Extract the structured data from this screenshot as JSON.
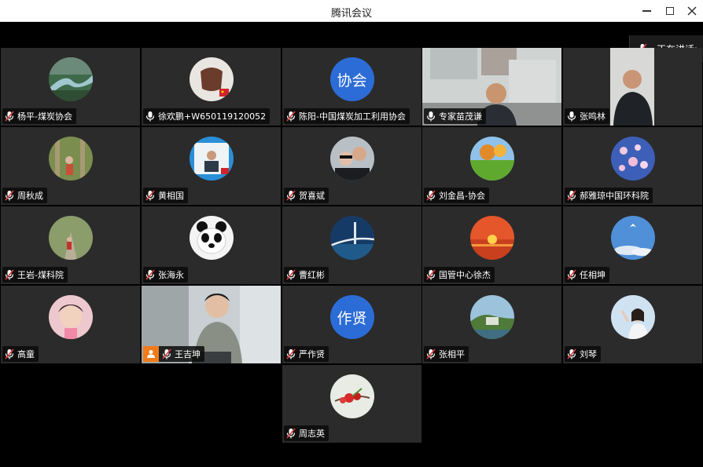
{
  "window": {
    "title": "腾讯会议"
  },
  "speaking": {
    "label": "正在讲话:"
  },
  "participants": [
    {
      "name": "杨平-煤炭协会",
      "muted": true,
      "avatar": "river-photo"
    },
    {
      "name": "徐欢鹏+W650119120052",
      "muted": false,
      "avatar": "fist-photo"
    },
    {
      "name": "陈阳-中国煤炭加工利用协会",
      "muted": true,
      "avatar_text": "协会"
    },
    {
      "name": "专家苗茂谦",
      "muted": false,
      "avatar": "video"
    },
    {
      "name": "张鸣林",
      "muted": false,
      "avatar": "video"
    },
    {
      "name": "周秋成",
      "muted": true,
      "avatar": "forest-photo"
    },
    {
      "name": "黄相国",
      "muted": true,
      "avatar": "portrait-photo"
    },
    {
      "name": "贺喜斌",
      "muted": true,
      "avatar": "couple-photo"
    },
    {
      "name": "刘金昌-协会",
      "muted": true,
      "avatar": "meadow-photo"
    },
    {
      "name": "郝雅琼中国环科院",
      "muted": true,
      "avatar": "blossom-photo"
    },
    {
      "name": "王岩-煤科院",
      "muted": true,
      "avatar": "road-photo"
    },
    {
      "name": "张海永",
      "muted": true,
      "avatar": "panda-photo"
    },
    {
      "name": "曹红彬",
      "muted": true,
      "avatar": "bridge-photo"
    },
    {
      "name": "国管中心徐杰",
      "muted": true,
      "avatar": "sunset-photo"
    },
    {
      "name": "任相坤",
      "muted": true,
      "avatar": "sky-photo"
    },
    {
      "name": "高童",
      "muted": true,
      "avatar": "child-photo"
    },
    {
      "name": "王吉坤",
      "muted": true,
      "avatar": "video"
    },
    {
      "name": "严作贤",
      "muted": true,
      "avatar_text": "作贤"
    },
    {
      "name": "张相平",
      "muted": true,
      "avatar": "island-photo"
    },
    {
      "name": "刘琴",
      "muted": true,
      "avatar": "woman-photo"
    },
    {
      "name": "周志英",
      "muted": true,
      "avatar": "flower-photo"
    }
  ]
}
